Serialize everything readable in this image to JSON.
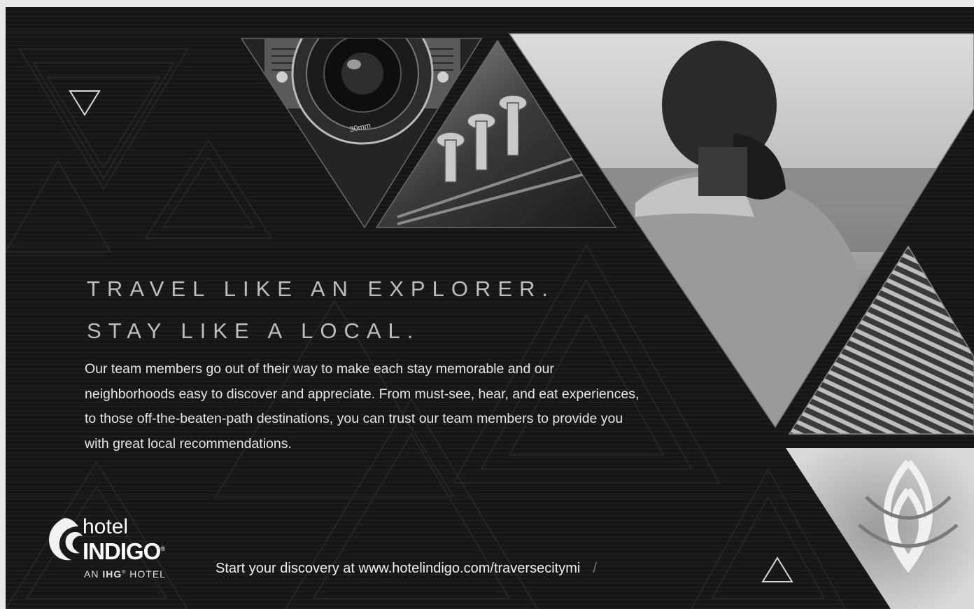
{
  "ad": {
    "headline_line1": "TRAVEL LIKE AN EXPLORER.",
    "headline_line2": "STAY LIKE A LOCAL.",
    "body": "Our team members go out of their way to make each stay memorable and our neighborhoods easy to discover and appreciate. From must-see, hear, and eat experiences, to those off-the-beaten-path destinations, you can trust our team members to provide you with great local recommendations.",
    "cta": "Start your discovery at www.hotelindigo.com/traversecitymi",
    "cta_suffix": "/"
  },
  "logo": {
    "hotel": "hotel",
    "indigo": "INDIGO",
    "registered": "®",
    "sub_prefix": "AN ",
    "sub_brand": "IHG",
    "sub_mark": "®",
    "sub_suffix": " HOTEL"
  },
  "camera_lens_text": "30mm",
  "colors": {
    "background": "#141414",
    "text_light": "#e6e6e6",
    "headline": "#bdbdbd"
  },
  "icons": [
    "triangle-down-icon",
    "triangle-up-icon",
    "hotel-indigo-logo-icon"
  ]
}
